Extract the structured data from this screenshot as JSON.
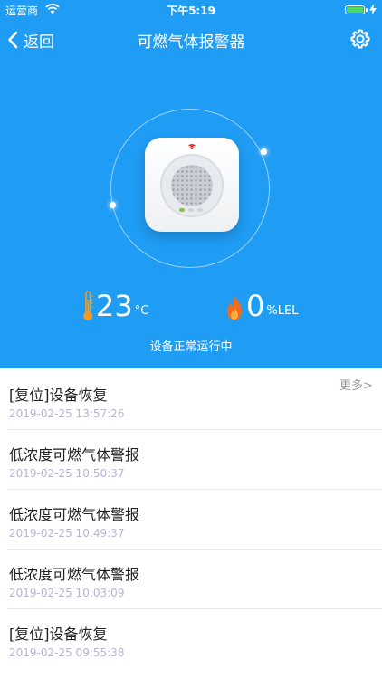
{
  "status_bar": {
    "carrier": "运营商",
    "time": "下午5:19"
  },
  "nav": {
    "back_label": "返回",
    "title": "可燃气体报警器"
  },
  "readings": {
    "temperature": {
      "value": "23",
      "unit": "°C"
    },
    "gas": {
      "value": "0",
      "unit": "%LEL"
    }
  },
  "device_status": "设备正常运行中",
  "records": {
    "more_label": "更多>",
    "items": [
      {
        "title": "[复位]设备恢复",
        "time": "2019-02-25 13:57:26"
      },
      {
        "title": "低浓度可燃气体警报",
        "time": "2019-02-25 10:50:37"
      },
      {
        "title": "低浓度可燃气体警报",
        "time": "2019-02-25 10:49:37"
      },
      {
        "title": "低浓度可燃气体警报",
        "time": "2019-02-25 10:03:09"
      },
      {
        "title": "[复位]设备恢复",
        "time": "2019-02-25 09:55:38"
      }
    ]
  },
  "colors": {
    "header_bg": "#1f9cf4",
    "thermometer": "#f39a1e",
    "flame": "#f06b1c",
    "timestamp": "#b7b5d6"
  },
  "icons": [
    "wifi-icon",
    "battery-icon",
    "back-chevron-icon",
    "gear-icon",
    "thermometer-icon",
    "flame-icon"
  ]
}
